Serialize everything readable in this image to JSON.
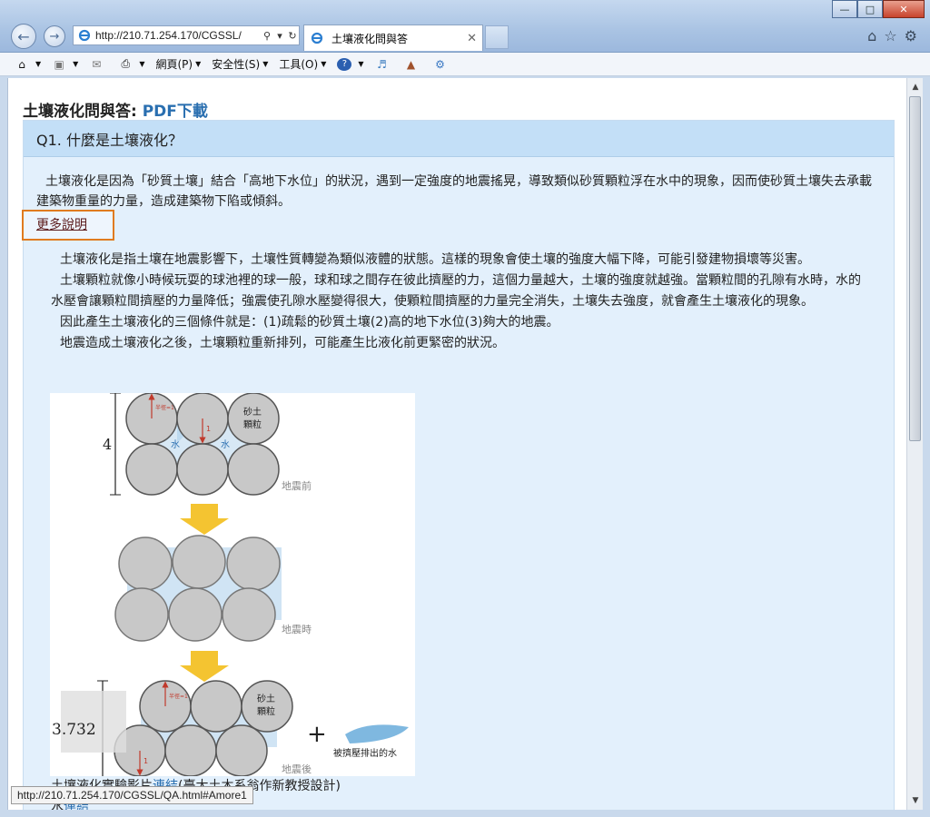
{
  "browser": {
    "address_url": "http://210.71.254.170/CGSSL/",
    "tab_title": "土壤液化問與答",
    "status_url": "http://210.71.254.170/CGSSL/QA.html#Amore1"
  },
  "command_bar": {
    "page_label": "網頁(P)",
    "safety_label": "安全性(S)",
    "tools_label": "工具(O)"
  },
  "page": {
    "heading": "土壤液化問與答: ",
    "pdf_link": "PDF下載"
  },
  "qa": {
    "question": "Q1. 什麼是土壤液化？",
    "answer": "土壤液化是因為「砂質土壤」結合「高地下水位」的狀況，遇到一定強度的地震搖晃，導致類似砂質顆粒浮在水中的現象，因而使砂質土壤失去承載建築物重量的力量，造成建築物下陷或傾斜。",
    "more_link": "更多說明",
    "details": [
      "土壤液化是指土壤在地震影響下，土壤性質轉變為類似液體的狀態。這樣的現象會使土壤的強度大幅下降，可能引發建物損壞等災害。",
      "土壤顆粒就像小時候玩耍的球池裡的球一般，球和球之間存在彼此擠壓的力，這個力量越大，土壤的強度就越強。當顆粒間的孔隙有水時，水的水壓會讓顆粒間擠壓的力量降低；強震使孔隙水壓變得很大，使顆粒間擠壓的力量完全消失，土壤失去強度，就會產生土壤液化的現象。",
      "因此產生土壤液化的三個條件就是：(1)疏鬆的砂質土壤(2)高的地下水位(3)夠大的地震。",
      "地震造成土壤液化之後，土壤顆粒重新排列，可能產生比液化前更緊密的狀況。"
    ],
    "caption_prefix": "土壤液化實驗影片",
    "caption_link": "連結",
    "caption_suffix": "(臺大土木系翁作新教授設計)",
    "caption_line2_prefix": "水",
    "caption_line2_link": "連結"
  },
  "figure": {
    "label_sand": "砂土",
    "label_particle": "顆粒",
    "label_water": "水",
    "label_before": "地震前",
    "label_during": "地震時",
    "label_after": "地震後",
    "label_height_before": "4",
    "label_height_after": "3.732",
    "label_radius": "半徑=1",
    "label_one": "1",
    "label_plus": "+",
    "label_expelled": "被擠壓排出的水"
  }
}
